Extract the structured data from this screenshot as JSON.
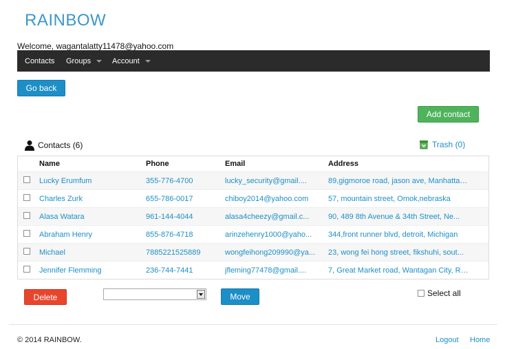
{
  "app": {
    "logo": "RAINBOW",
    "welcome": "Welcome, wagantalatty11478@yahoo.com"
  },
  "nav": {
    "contacts": "Contacts",
    "groups": "Groups",
    "account": "Account"
  },
  "buttons": {
    "go_back": "Go back",
    "add_contact": "Add contact",
    "delete": "Delete",
    "move": "Move"
  },
  "contacts_header": {
    "label": "Contacts (6)"
  },
  "trash": {
    "label": "Trash (0)"
  },
  "table": {
    "headers": {
      "name": "Name",
      "phone": "Phone",
      "email": "Email",
      "address": "Address"
    },
    "rows": [
      {
        "name": "Lucky Erumfum",
        "phone": "355-776-4700",
        "email": "lucky_security@gmail....",
        "address": "89,gigmoroe road, jason ave, Manhattan ..."
      },
      {
        "name": "Charles Zurk",
        "phone": "655-786-0017",
        "email": "chiboy2014@yahoo.com",
        "address": "57, mountain street, Omok,nebraska"
      },
      {
        "name": "Alasa Watara",
        "phone": "961-144-4044",
        "email": "alasa4cheezy@gmail.c...",
        "address": "90, 489 8th Avenue & 34th Street, Ne..."
      },
      {
        "name": "Abraham Henry",
        "phone": "855-876-4718",
        "email": "arinzehenry1000@yaho...",
        "address": "344,front runner blvd, detroit, Michigan"
      },
      {
        "name": "Michael",
        "phone": "7885221525889",
        "email": "wongfeihong209990@ya...",
        "address": "23, wong fei hong street, fikshuhi, sout..."
      },
      {
        "name": "Jennifer Flemming",
        "phone": "236-744-7441",
        "email": "jfleming77478@gmail....",
        "address": "7, Great Market road, Wantagan City, Rio..."
      }
    ]
  },
  "move_select": {
    "value": ""
  },
  "select_all": {
    "label": "Select all"
  },
  "footer": {
    "copyright": "© 2014  RAINBOW.",
    "logout": "Logout",
    "home": "Home"
  },
  "colors": {
    "brand": "#3b97c9",
    "primary": "#1d8fc6",
    "success": "#4fb35c",
    "danger": "#e8452d",
    "navbar": "#2b2b2b"
  },
  "icons": {
    "contacts": "person-icon",
    "trash": "trash-icon"
  }
}
